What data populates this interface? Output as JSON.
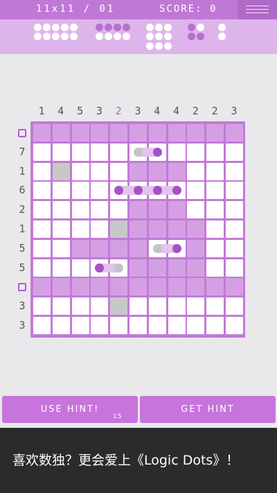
{
  "header": {
    "level_label": "11x11 / 01",
    "score_label": "SCORE: 0"
  },
  "ships": [
    [
      {
        "dots": [
          "w",
          "w",
          "w",
          "w",
          "w"
        ]
      },
      {
        "dots": [
          "w",
          "w",
          "w",
          "w",
          "w"
        ]
      }
    ],
    [
      {
        "dots": [
          "p",
          "p",
          "p",
          "p"
        ]
      },
      {
        "dots": [
          "w",
          "w",
          "w",
          "w"
        ]
      }
    ],
    [
      {
        "dots": [
          "w",
          "w",
          "w"
        ]
      },
      {
        "dots": [
          "w",
          "w",
          "w"
        ]
      },
      {
        "dots": [
          "w",
          "w",
          "w"
        ]
      }
    ],
    [
      {
        "dots": [
          "p",
          "w"
        ]
      },
      {
        "dots": [
          "p",
          "p"
        ]
      }
    ],
    [
      {
        "dots": [
          "w"
        ]
      },
      {
        "dots": [
          "w"
        ]
      }
    ]
  ],
  "col_clues": [
    "1",
    "4",
    "5",
    "3",
    "2",
    "3",
    "4",
    "4",
    "2",
    "2",
    "3"
  ],
  "highlighted_col": 4,
  "row_clues": [
    "0",
    "7",
    "1",
    "6",
    "2",
    "1",
    "5",
    "5",
    "0",
    "3",
    "3"
  ],
  "grid": [
    "PPPPPPPPPPP",
    "WWWWWWWWWWW",
    "WGWWWPPPWWW",
    "WWWWWWWWWWW",
    "WWWWWPPPWWW",
    "WWWWGPPPPWW",
    "WWPPPPWWPWW",
    "WWWWWPPPPWW",
    "PPPPPPPPPPP",
    "WWWWGWWWWWW",
    "WWWWWWWWWWW"
  ],
  "grid_dots": [
    {
      "row": 1,
      "col": 5,
      "color": "gray"
    },
    {
      "row": 1,
      "col": 6,
      "color": "purple"
    },
    {
      "row": 3,
      "col": 4,
      "color": "purple"
    },
    {
      "row": 3,
      "col": 5,
      "color": "purple"
    },
    {
      "row": 3,
      "col": 6,
      "color": "purple"
    },
    {
      "row": 3,
      "col": 7,
      "color": "purple"
    },
    {
      "row": 6,
      "col": 6,
      "color": "gray"
    },
    {
      "row": 6,
      "col": 7,
      "color": "purple"
    },
    {
      "row": 7,
      "col": 3,
      "color": "purple"
    },
    {
      "row": 7,
      "col": 4,
      "color": "gray"
    }
  ],
  "grid_links": [
    {
      "row": 1,
      "from": 5,
      "to": 6
    },
    {
      "row": 3,
      "from": 4,
      "to": 7
    },
    {
      "row": 6,
      "from": 6,
      "to": 7
    },
    {
      "row": 7,
      "from": 3,
      "to": 4
    }
  ],
  "buttons": {
    "use_hint": "USE HINT!",
    "hint_count": "15",
    "get_hint": "GET HINT"
  },
  "banner_text": "喜欢数独？更会爱上《Logic Dots》！",
  "colors": {
    "accent": "#c078d6",
    "panel": "#ddb5ea",
    "cell_fill": "#d4a0e3",
    "dot": "#a651c8"
  }
}
